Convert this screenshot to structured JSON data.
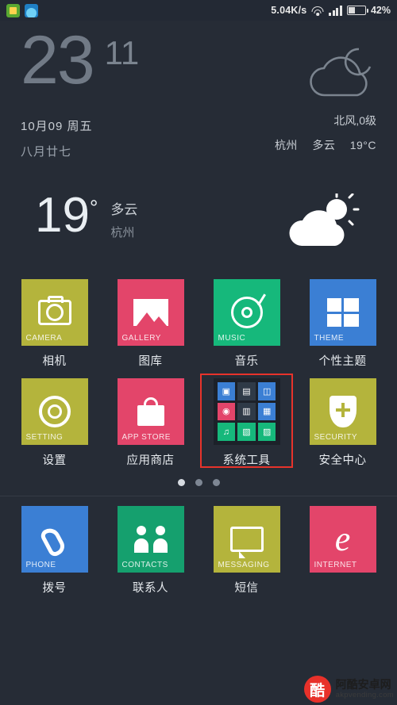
{
  "status_bar": {
    "icons": [
      "app-icon-green",
      "app-icon-blue"
    ],
    "net_speed": "5.04K/s",
    "wifi": "wifi-icon",
    "signal": "signal-bars-icon",
    "battery_icon": "battery-icon",
    "battery_percent": "42%"
  },
  "clock_widget": {
    "hour": "23",
    "minute": "11",
    "date_line": "10月09  周五",
    "lunar_line": "八月廿七",
    "weather_icon": "cloudy-night-icon",
    "wind": "北风,0级",
    "city": "杭州",
    "condition": "多云",
    "temp": "19°C"
  },
  "weather_widget": {
    "temp": "19",
    "degree": "°",
    "condition": "多云",
    "city": "杭州",
    "icon": "sun-cloud-icon"
  },
  "rows": [
    {
      "apps": [
        {
          "tag": "CAMERA",
          "cn": "相机",
          "tile": "t-olive",
          "glyph": "camera-icon",
          "selected": false
        },
        {
          "tag": "GALLERY",
          "cn": "图库",
          "tile": "t-pink",
          "glyph": "gallery-icon",
          "selected": false
        },
        {
          "tag": "MUSIC",
          "cn": "音乐",
          "tile": "t-green",
          "glyph": "music-disc-icon",
          "selected": false
        },
        {
          "tag": "THEME",
          "cn": "个性主题",
          "tile": "t-blue",
          "glyph": "windows-icon",
          "selected": false
        }
      ]
    },
    {
      "apps": [
        {
          "tag": "SETTING",
          "cn": "设置",
          "tile": "t-olive",
          "glyph": "gear-icon",
          "selected": false
        },
        {
          "tag": "APP STORE",
          "cn": "应用商店",
          "tile": "t-pink",
          "glyph": "shopping-bag-icon",
          "selected": false
        },
        {
          "tag": "",
          "cn": "系统工具",
          "tile": "t-tools",
          "glyph": "tools-folder-icon",
          "selected": true
        },
        {
          "tag": "SECURITY",
          "cn": "安全中心",
          "tile": "t-olive",
          "glyph": "shield-plus-icon",
          "selected": false
        }
      ]
    },
    {
      "apps": [
        {
          "tag": "PHONE",
          "cn": "拨号",
          "tile": "t-phone",
          "glyph": "phone-icon",
          "selected": false
        },
        {
          "tag": "CONTACTS",
          "cn": "联系人",
          "tile": "t-contacts",
          "glyph": "contacts-icon",
          "selected": false
        },
        {
          "tag": "MESSAGING",
          "cn": "短信",
          "tile": "t-msg",
          "glyph": "message-icon",
          "selected": false
        },
        {
          "tag": "INTERNET",
          "cn": "",
          "tile": "t-net",
          "glyph": "browser-e-icon",
          "selected": false
        }
      ]
    }
  ],
  "tools_tile_cells": [
    "▣",
    "▤",
    "◫",
    "◉",
    "▥",
    "▦",
    "♫",
    "▧",
    "▨"
  ],
  "page_dots": {
    "count": 3,
    "active_index": 0
  },
  "watermark": {
    "badge": "酷",
    "line1": "阿酷安卓网",
    "line2": "akpvending.com"
  }
}
